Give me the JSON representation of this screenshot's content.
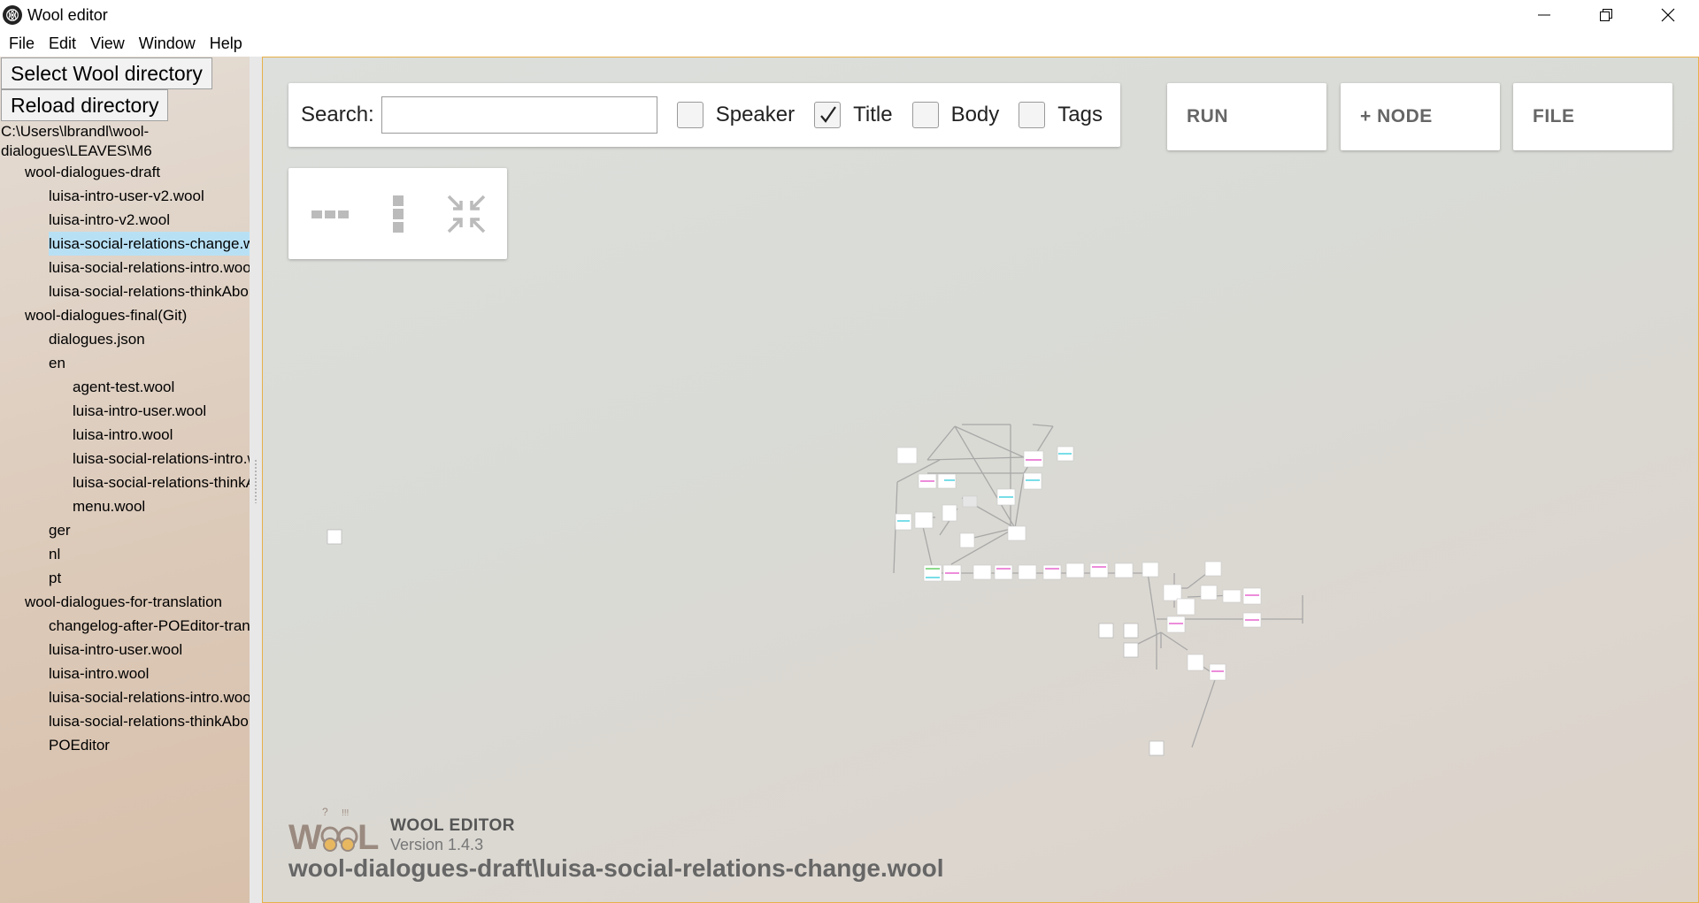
{
  "window": {
    "title": "Wool editor"
  },
  "menu": [
    "File",
    "Edit",
    "View",
    "Window",
    "Help"
  ],
  "sidebar": {
    "select_button": "Select Wool directory",
    "reload_button": "Reload directory",
    "path": "C:\\Users\\lbrandl\\wool-dialogues\\LEAVES\\M6",
    "tree": [
      {
        "label": "wool-dialogues-draft",
        "level": 1
      },
      {
        "label": "luisa-intro-user-v2.wool",
        "level": 2
      },
      {
        "label": "luisa-intro-v2.wool",
        "level": 2
      },
      {
        "label": "luisa-social-relations-change.wool",
        "level": 2,
        "selected": true
      },
      {
        "label": "luisa-social-relations-intro.wool",
        "level": 2
      },
      {
        "label": "luisa-social-relations-thinkAbout.wool",
        "level": 2
      },
      {
        "label": "wool-dialogues-final(Git)",
        "level": 1
      },
      {
        "label": "dialogues.json",
        "level": 2
      },
      {
        "label": "en",
        "level": 2
      },
      {
        "label": "agent-test.wool",
        "level": 3
      },
      {
        "label": "luisa-intro-user.wool",
        "level": 3
      },
      {
        "label": "luisa-intro.wool",
        "level": 3
      },
      {
        "label": "luisa-social-relations-intro.wool",
        "level": 3
      },
      {
        "label": "luisa-social-relations-thinkAbout.wool",
        "level": 3
      },
      {
        "label": "menu.wool",
        "level": 3
      },
      {
        "label": "ger",
        "level": 2
      },
      {
        "label": "nl",
        "level": 2
      },
      {
        "label": "pt",
        "level": 2
      },
      {
        "label": "wool-dialogues-for-translation",
        "level": 1
      },
      {
        "label": "changelog-after-POEditor-translation",
        "level": 2
      },
      {
        "label": "luisa-intro-user.wool",
        "level": 2
      },
      {
        "label": "luisa-intro.wool",
        "level": 2
      },
      {
        "label": "luisa-social-relations-intro.wool",
        "level": 2
      },
      {
        "label": "luisa-social-relations-thinkAbout.wool",
        "level": 2
      },
      {
        "label": "POEditor",
        "level": 2
      }
    ]
  },
  "toolbar": {
    "search_label": "Search:",
    "search_value": "",
    "filters": [
      {
        "label": "Speaker",
        "checked": false
      },
      {
        "label": "Title",
        "checked": true
      },
      {
        "label": "Body",
        "checked": false
      },
      {
        "label": "Tags",
        "checked": false
      }
    ],
    "run_label": "RUN",
    "node_label": "+ NODE",
    "file_label": "FILE"
  },
  "layout_tools": {
    "icons": [
      "arrange-horizontal-icon",
      "arrange-vertical-icon",
      "collapse-icon"
    ]
  },
  "footer": {
    "brand": "WOOL EDITOR",
    "version": "Version 1.4.3",
    "current_file": "wool-dialogues-draft\\luisa-social-relations-change.wool"
  },
  "colors": {
    "selected_item": "#b8e0f4",
    "canvas_border": "#e8b04a",
    "accent_pink": "#e040c0",
    "accent_cyan": "#20c8d8",
    "accent_green": "#40c040"
  }
}
